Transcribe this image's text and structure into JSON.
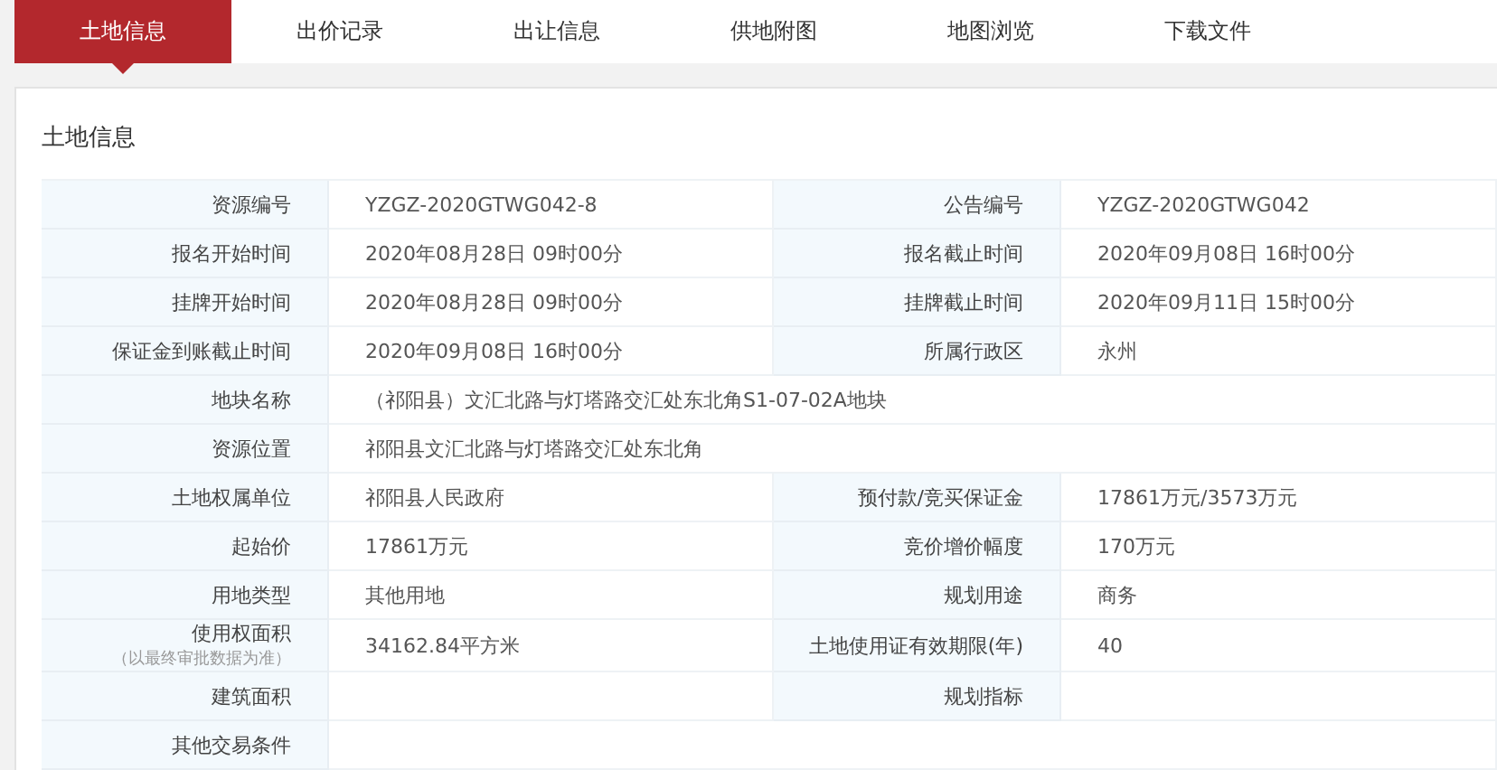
{
  "tabs": [
    {
      "label": "土地信息",
      "selected": true
    },
    {
      "label": "出价记录",
      "selected": false
    },
    {
      "label": "出让信息",
      "selected": false
    },
    {
      "label": "供地附图",
      "selected": false
    },
    {
      "label": "地图浏览",
      "selected": false
    },
    {
      "label": "下载文件",
      "selected": false
    }
  ],
  "section": {
    "title": "土地信息"
  },
  "rows": [
    {
      "fields": [
        {
          "label": "资源编号",
          "value": "YZGZ-2020GTWG042-8"
        },
        {
          "label": "公告编号",
          "value": "YZGZ-2020GTWG042"
        }
      ]
    },
    {
      "fields": [
        {
          "label": "报名开始时间",
          "value": "2020年08月28日 09时00分"
        },
        {
          "label": "报名截止时间",
          "value": "2020年09月08日 16时00分"
        }
      ]
    },
    {
      "fields": [
        {
          "label": "挂牌开始时间",
          "value": "2020年08月28日 09时00分"
        },
        {
          "label": "挂牌截止时间",
          "value": "2020年09月11日 15时00分"
        }
      ]
    },
    {
      "fields": [
        {
          "label": "保证金到账截止时间",
          "value": "2020年09月08日 16时00分"
        },
        {
          "label": "所属行政区",
          "value": "永州"
        }
      ]
    },
    {
      "fields": [
        {
          "label": "地块名称",
          "value": "（祁阳县）文汇北路与灯塔路交汇处东北角S1-07-02A地块"
        }
      ]
    },
    {
      "fields": [
        {
          "label": "资源位置",
          "value": "祁阳县文汇北路与灯塔路交汇处东北角"
        }
      ]
    },
    {
      "fields": [
        {
          "label": "土地权属单位",
          "value": "祁阳县人民政府"
        },
        {
          "label": "预付款/竞买保证金",
          "value": "17861万元/3573万元"
        }
      ]
    },
    {
      "fields": [
        {
          "label": "起始价",
          "value": "17861万元"
        },
        {
          "label": "竞价增价幅度",
          "value": "170万元"
        }
      ]
    },
    {
      "fields": [
        {
          "label": "用地类型",
          "value": "其他用地"
        },
        {
          "label": "规划用途",
          "value": "商务"
        }
      ]
    },
    {
      "fields": [
        {
          "label": "使用权面积",
          "note": "（以最终审批数据为准）",
          "value": "34162.84平方米"
        },
        {
          "label": "土地使用证有效期限(年)",
          "value": "40"
        }
      ]
    },
    {
      "fields": [
        {
          "label": "建筑面积"
        },
        {
          "label": "规划指标"
        }
      ]
    },
    {
      "fields": [
        {
          "label": "其他交易条件"
        }
      ]
    }
  ]
}
